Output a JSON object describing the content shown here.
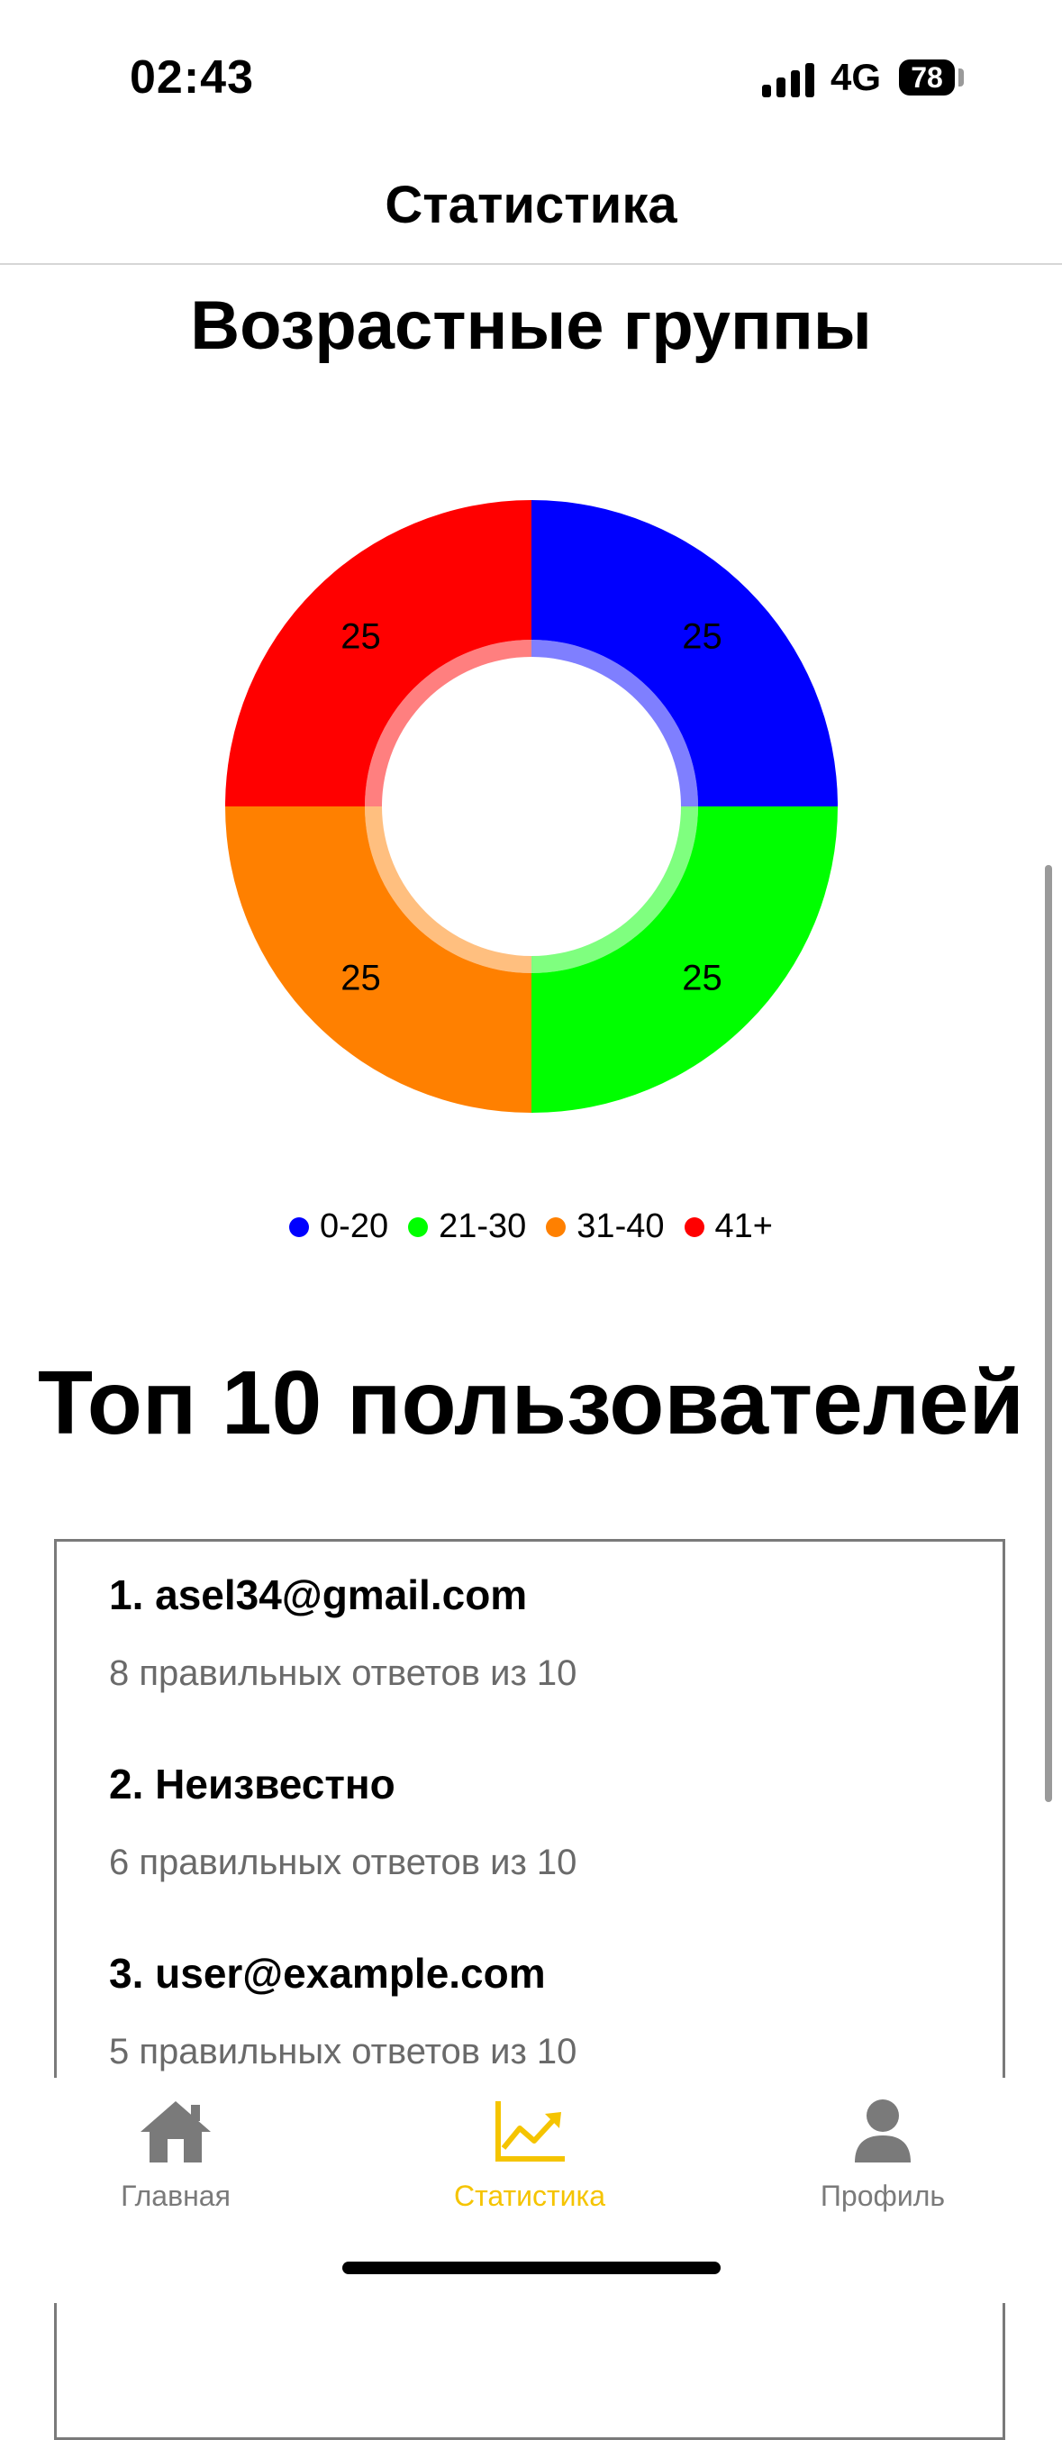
{
  "status_bar": {
    "time": "02:43",
    "network": "4G",
    "battery": "78"
  },
  "header": {
    "title": "Статистика"
  },
  "age_section": {
    "title": "Возрастные группы"
  },
  "chart_data": {
    "type": "pie",
    "categories": [
      "0-20",
      "21-30",
      "31-40",
      "41+"
    ],
    "values": [
      25,
      25,
      25,
      25
    ],
    "colors": [
      "#0000ff",
      "#00ff00",
      "#ff8000",
      "#ff0000"
    ],
    "labels": [
      "25",
      "25",
      "25",
      "25"
    ],
    "legend_position": "bottom",
    "donut": true
  },
  "legend": [
    {
      "label": "0-20",
      "color": "#0000ff"
    },
    {
      "label": "21-30",
      "color": "#00ff00"
    },
    {
      "label": "31-40",
      "color": "#ff8000"
    },
    {
      "label": "41+",
      "color": "#ff0000"
    }
  ],
  "top_users": {
    "title": "Топ 10 пользователей",
    "items": [
      {
        "name": "1. asel34@gmail.com",
        "score": "8 правильных ответов из 10"
      },
      {
        "name": "2. Неизвестно",
        "score": "6 правильных ответов из 10"
      },
      {
        "name": "3. user@example.com",
        "score": "5 правильных ответов из 10"
      }
    ]
  },
  "tab_bar": {
    "tabs": [
      {
        "label": "Главная",
        "icon": "home-icon",
        "active": false
      },
      {
        "label": "Статистика",
        "icon": "chart-line-icon",
        "active": true
      },
      {
        "label": "Профиль",
        "icon": "profile-icon",
        "active": false
      }
    ],
    "active_color": "#f5c400",
    "inactive_color": "#7a7a7a"
  }
}
